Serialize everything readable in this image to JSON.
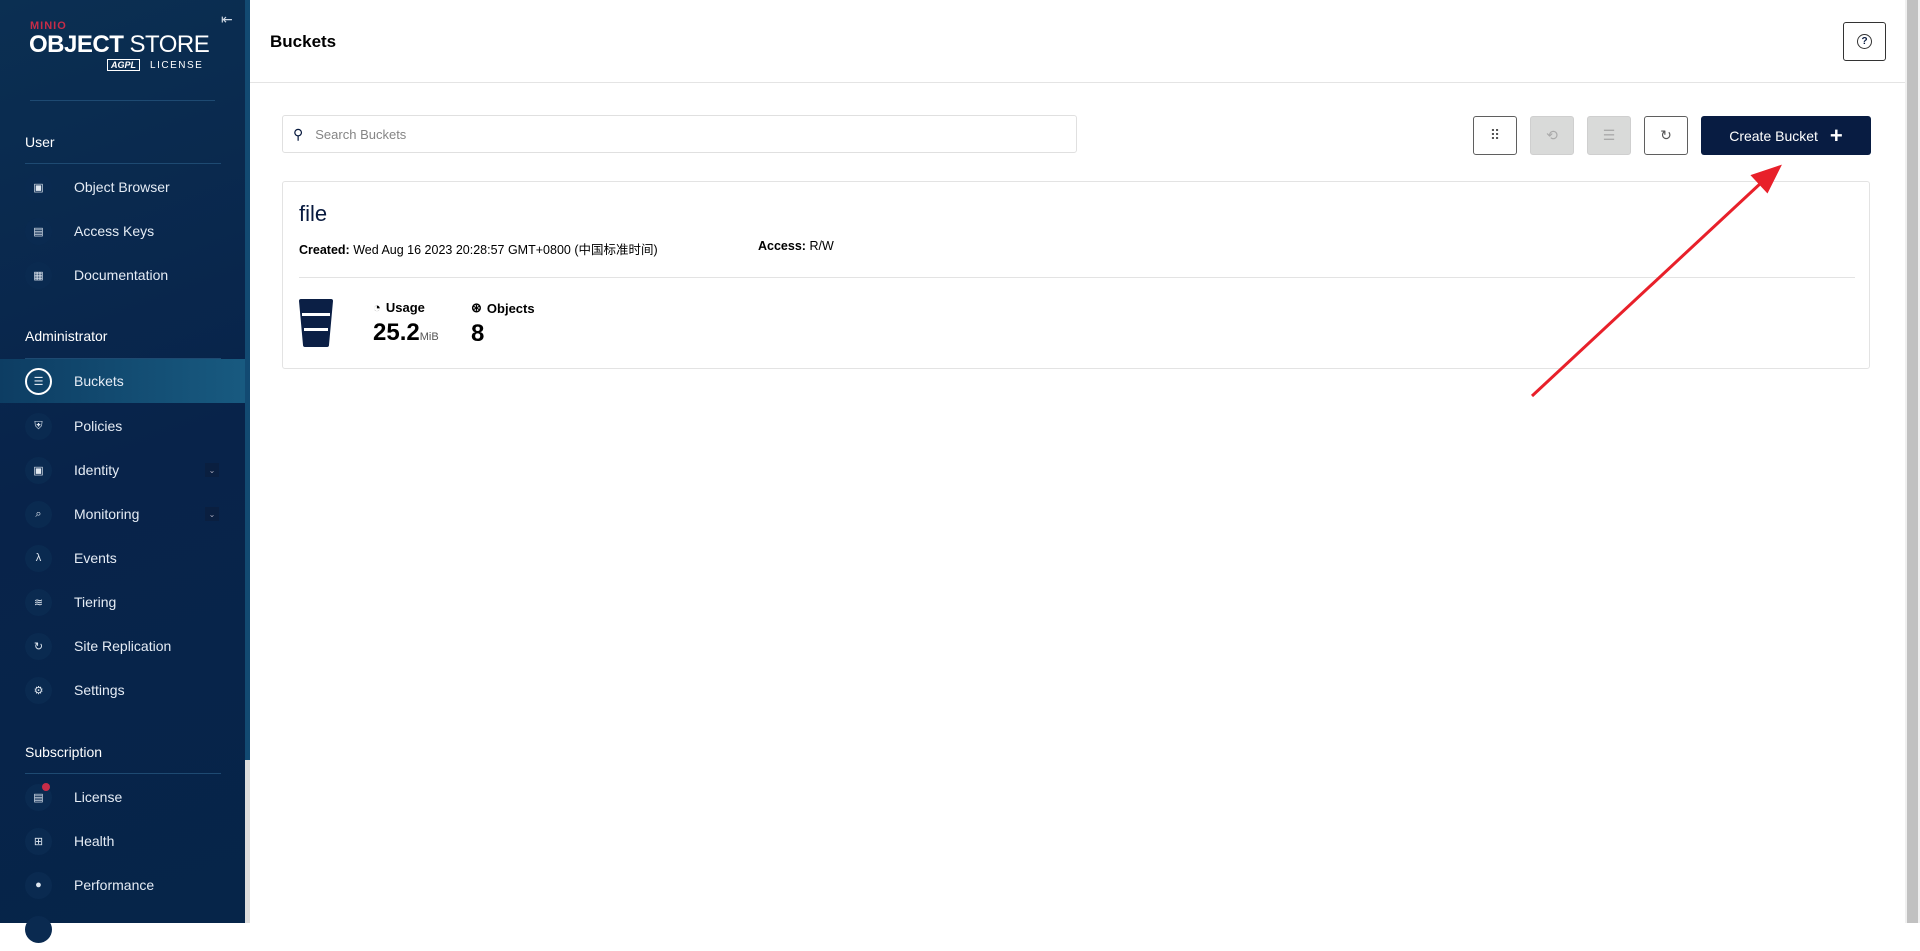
{
  "sidebar": {
    "logo": {
      "brand": "MINIO",
      "product_bold": "OBJECT",
      "product": " STORE",
      "license_badge": "AGPL",
      "license": "LICENSE"
    },
    "collapse_icon": "collapse-left-icon",
    "sections": [
      {
        "title": "User",
        "items": [
          {
            "label": "Object Browser",
            "icon": "object-browser-icon"
          },
          {
            "label": "Access Keys",
            "icon": "access-keys-icon"
          },
          {
            "label": "Documentation",
            "icon": "documentation-icon"
          }
        ]
      },
      {
        "title": "Administrator",
        "items": [
          {
            "label": "Buckets",
            "icon": "bucket-icon",
            "active": true
          },
          {
            "label": "Policies",
            "icon": "policy-icon"
          },
          {
            "label": "Identity",
            "icon": "identity-icon",
            "expandable": true
          },
          {
            "label": "Monitoring",
            "icon": "monitoring-icon",
            "expandable": true
          },
          {
            "label": "Events",
            "icon": "lambda-icon"
          },
          {
            "label": "Tiering",
            "icon": "tiering-icon"
          },
          {
            "label": "Site Replication",
            "icon": "replication-icon"
          },
          {
            "label": "Settings",
            "icon": "gear-icon"
          }
        ]
      },
      {
        "title": "Subscription",
        "items": [
          {
            "label": "License",
            "icon": "license-icon",
            "notification": true
          },
          {
            "label": "Health",
            "icon": "health-icon"
          },
          {
            "label": "Performance",
            "icon": "performance-icon"
          }
        ]
      }
    ]
  },
  "header": {
    "title": "Buckets",
    "help_icon": "?"
  },
  "toolbar": {
    "search_placeholder": "Search Buckets",
    "create_label": "Create Bucket"
  },
  "buckets": [
    {
      "name": "file",
      "created_label": "Created:",
      "created": "Wed Aug 16 2023 20:28:57 GMT+0800 (中国标准时间)",
      "access_label": "Access:",
      "access": "R/W",
      "usage_label": "Usage",
      "usage_value": "25.2",
      "usage_unit": "MiB",
      "objects_label": "Objects",
      "objects_value": "8"
    }
  ],
  "colors": {
    "sidebar": "#08234a",
    "primary": "#081c42",
    "annotation_arrow": "#e8202a",
    "notification": "#c72c48"
  }
}
